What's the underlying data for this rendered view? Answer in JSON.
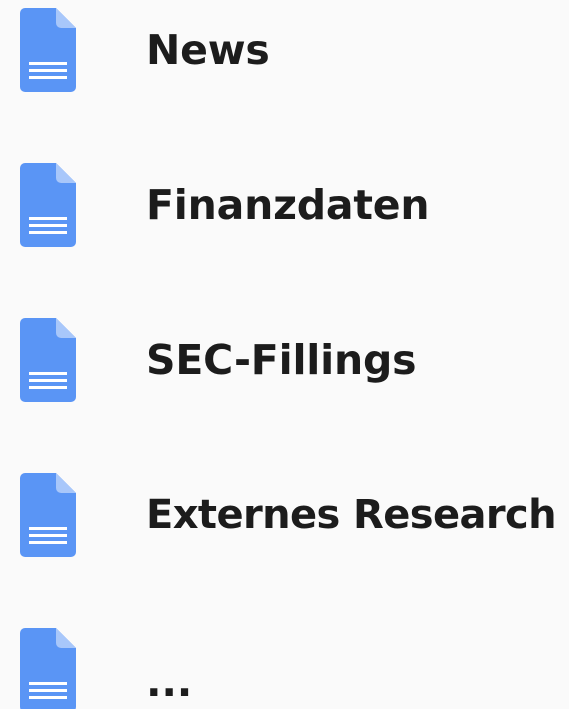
{
  "file_list": {
    "items": [
      {
        "label": "News",
        "icon": "document-icon"
      },
      {
        "label": "Finanzdaten",
        "icon": "document-icon"
      },
      {
        "label": "SEC-Fillings",
        "icon": "document-icon"
      },
      {
        "label": "Externes Research",
        "icon": "document-icon"
      },
      {
        "label": "...",
        "icon": "document-icon"
      }
    ]
  },
  "colors": {
    "icon_body": "#5a95f5",
    "icon_fold": "#a8c7fa",
    "icon_lines": "#ffffff",
    "text": "#1c1c1c",
    "background": "#fafafa"
  }
}
